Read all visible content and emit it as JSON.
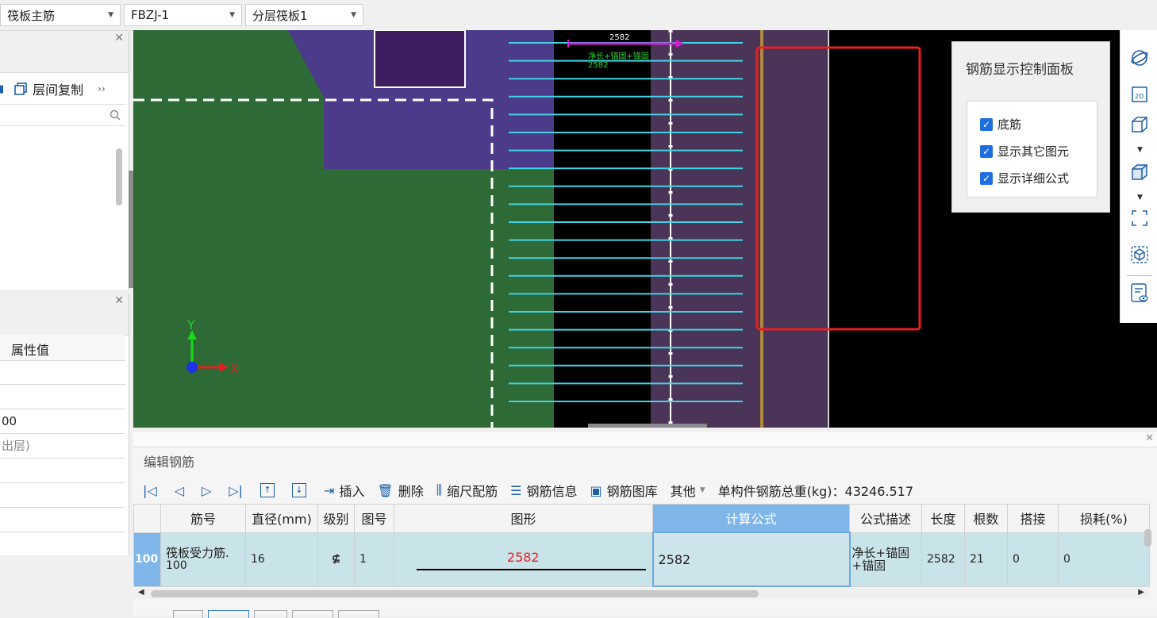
{
  "selectors": [
    {
      "value": "筏板主筋"
    },
    {
      "value": "FBZJ-1"
    },
    {
      "value": "分层筏板1"
    }
  ],
  "left_panel_top": {
    "layer_copy_label": "层间复制",
    "more_label": "››"
  },
  "left_panel_bottom": {
    "header": "属性值",
    "rows": [
      "",
      "",
      "00",
      "出层)",
      "",
      "",
      ""
    ]
  },
  "viewport": {
    "dimension_value": "2582",
    "formula_annotation": "净长+锚固+锚固",
    "formula_annotation_line2": "2582",
    "axis_x": "X",
    "axis_y": "Y",
    "colors": {
      "green_slab": "#2d6a35",
      "purple_slab": "#4c3a8a",
      "highlight_red": "#e62020",
      "rebar_cyan": "#3fd4e6",
      "dim_magenta": "#d01ed0"
    }
  },
  "control_panel": {
    "title": "钢筋显示控制面板",
    "options": [
      {
        "label": "底筋",
        "checked": true
      },
      {
        "label": "显示其它图元",
        "checked": true
      },
      {
        "label": "显示详细公式",
        "checked": true
      }
    ]
  },
  "right_toolbar": {
    "icons": [
      "orbit-icon",
      "2d-view-icon",
      "3d-view-icon",
      "3d-solid-icon",
      "fit-view-icon",
      "component-view-icon",
      "display-settings-icon"
    ],
    "label_2d": "2D"
  },
  "editor": {
    "title": "编辑钢筋",
    "toolbar": {
      "insert": "插入",
      "delete": "删除",
      "scale_rebar": "缩尺配筋",
      "rebar_info": "钢筋信息",
      "rebar_library": "钢筋图库",
      "other": "其他",
      "total_weight": "单构件钢筋总重(kg)：43246.517"
    },
    "columns": [
      "",
      "筋号",
      "直径(mm)",
      "级别",
      "图号",
      "图形",
      "计算公式",
      "公式描述",
      "长度",
      "根数",
      "搭接",
      "损耗(%)"
    ],
    "rows": [
      {
        "index": "100",
        "bar_name": "筏板受力筋.",
        "bar_name_2": "100",
        "diameter": "16",
        "grade": "⊈",
        "shape_no": "1",
        "shape_value": "2582",
        "formula": "2582",
        "formula_desc": "净长+锚固",
        "formula_desc_2": "+锚固",
        "length": "2582",
        "count": "21",
        "lap": "0",
        "loss": "0"
      }
    ]
  }
}
